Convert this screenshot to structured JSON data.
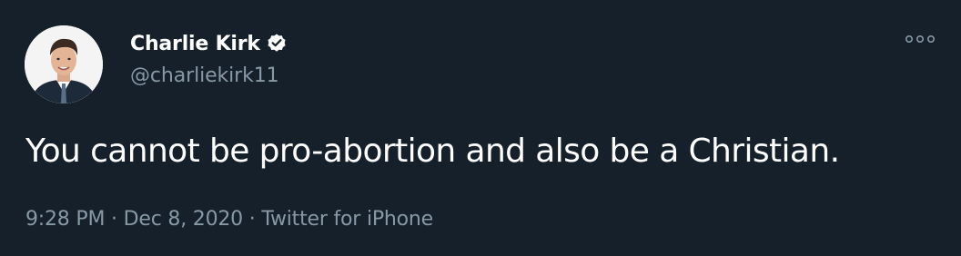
{
  "tweet": {
    "author": {
      "display_name": "Charlie Kirk",
      "handle": "@charliekirk11",
      "verified": true,
      "avatar_icon": "profile-photo"
    },
    "text": "You cannot be pro-abortion and also be a Christian.",
    "time": "9:28 PM",
    "date": "Dec 8, 2020",
    "source": "Twitter for iPhone",
    "separator": "·",
    "more_icon": "more-options-icon"
  },
  "colors": {
    "background": "#15202b",
    "primary_text": "#ffffff",
    "secondary_text": "#8899a6"
  }
}
